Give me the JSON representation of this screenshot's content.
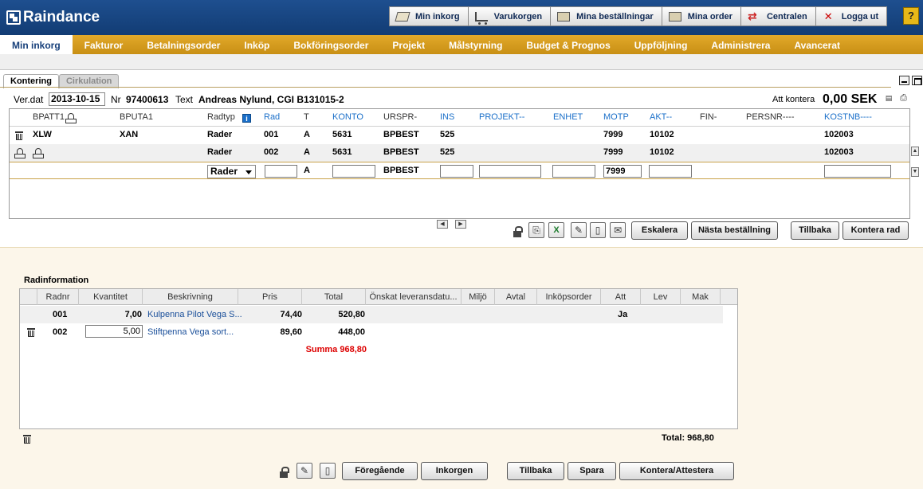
{
  "app": {
    "logo_text": "Raindance"
  },
  "topnav": [
    {
      "label": "Min inkorg",
      "icon": "inbox-icon"
    },
    {
      "label": "Varukorgen",
      "icon": "cart-icon"
    },
    {
      "label": "Mina beställningar",
      "icon": "orders-icon"
    },
    {
      "label": "Mina order",
      "icon": "order-icon"
    },
    {
      "label": "Centralen",
      "icon": "central-icon"
    },
    {
      "label": "Logga ut",
      "icon": "logout-icon"
    }
  ],
  "help_label": "?",
  "mainnav": [
    {
      "label": "Min inkorg",
      "active": true
    },
    {
      "label": "Fakturor"
    },
    {
      "label": "Betalningsorder"
    },
    {
      "label": "Inköp"
    },
    {
      "label": "Bokföringsorder"
    },
    {
      "label": "Projekt"
    },
    {
      "label": "Målstyrning"
    },
    {
      "label": "Budget & Prognos"
    },
    {
      "label": "Uppföljning"
    },
    {
      "label": "Administrera"
    },
    {
      "label": "Avancerat"
    }
  ],
  "tabs": [
    {
      "label": "Kontering"
    },
    {
      "label": "Cirkulation"
    }
  ],
  "header_info": {
    "verdat_label": "Ver.dat",
    "verdat_value": "2013-10-15",
    "nr_label": "Nr",
    "nr_value": "97400613",
    "text_label": "Text",
    "text_value": "Andreas Nylund, CGI B131015-2",
    "att_kontera_label": "Att kontera",
    "att_kontera_value": "0,00 SEK"
  },
  "kontering": {
    "columns": {
      "bpatt1": "BPATT1",
      "bputa1": "BPUTA1",
      "radtyp": "Radtyp",
      "rad": "Rad",
      "t": "T",
      "konto": "KONTO",
      "urspr": "URSPR-",
      "ins": "INS",
      "projekt": "PROJEKT--",
      "enhet": "ENHET",
      "motp": "MOTP",
      "akt": "AKT--",
      "fin": "FIN-",
      "persnr": "PERSNR----",
      "kostnb": "KOSTNB----"
    },
    "rows": [
      {
        "bpatt1": "XLW",
        "bputa1": "XAN",
        "radtyp": "Rader",
        "rad": "001",
        "t": "A",
        "konto": "5631",
        "urspr": "BPBEST",
        "ins": "525",
        "motp": "7999",
        "akt": "10102",
        "kostnb": "102003"
      },
      {
        "bpatt1": "",
        "bputa1": "",
        "radtyp": "Rader",
        "rad": "002",
        "t": "A",
        "konto": "5631",
        "urspr": "BPBEST",
        "ins": "525",
        "motp": "7999",
        "akt": "10102",
        "kostnb": "102003"
      }
    ],
    "entry": {
      "radtyp": "Rader",
      "t": "A",
      "urspr": "BPBEST",
      "motp": "7999"
    }
  },
  "actions_top": {
    "eskalera": "Eskalera",
    "nasta": "Nästa beställning",
    "tillbaka": "Tillbaka",
    "kontera_rad": "Kontera rad"
  },
  "radinformation": {
    "title": "Radinformation",
    "columns": [
      "Radnr",
      "Kvantitet",
      "Beskrivning",
      "Pris",
      "Total",
      "Önskat leveransdatu...",
      "Miljö",
      "Avtal",
      "Inköpsorder",
      "Att",
      "Lev",
      "Mak"
    ],
    "rows": [
      {
        "radnr": "001",
        "kvantitet": "7,00",
        "beskrivning": "Kulpenna Pilot Vega S...",
        "pris": "74,40",
        "total": "520,80",
        "att": "Ja"
      },
      {
        "radnr": "002",
        "kvantitet": "5,00",
        "beskrivning": "Stiftpenna Vega sort...",
        "pris": "89,60",
        "total": "448,00",
        "att": ""
      }
    ],
    "summa": "Summa 968,80",
    "total_label": "Total: 968,80"
  },
  "actions_bottom": {
    "foregaende": "Föregående",
    "inkorgen": "Inkorgen",
    "tillbaka": "Tillbaka",
    "spara": "Spara",
    "kontera": "Kontera/Attestera"
  }
}
